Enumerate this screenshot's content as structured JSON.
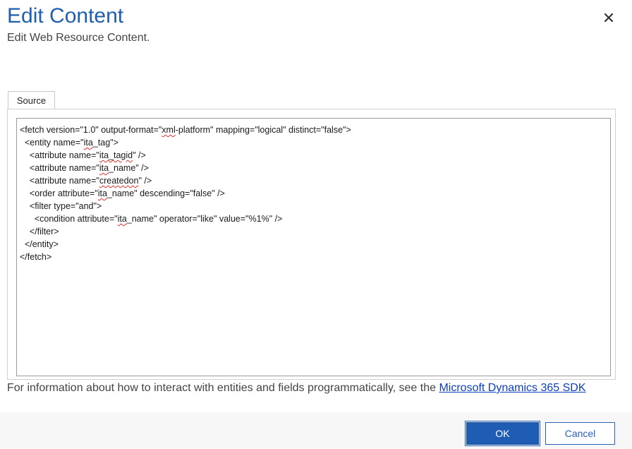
{
  "dialog": {
    "title": "Edit Content",
    "subtitle": "Edit Web Resource Content.",
    "close_icon": "close-icon"
  },
  "tabs": [
    {
      "label": "Source",
      "selected": true
    }
  ],
  "editor": {
    "lines": [
      [
        {
          "t": "<fetch version=\"1.0\" output-format=\""
        },
        {
          "t": "xml",
          "sq": true
        },
        {
          "t": "-platform\" mapping=\"logical\" distinct=\"false\">"
        }
      ],
      [
        {
          "t": "  <entity name=\""
        },
        {
          "t": "ita",
          "sq": true
        },
        {
          "t": "_tag\">"
        }
      ],
      [
        {
          "t": "    <attribute name=\""
        },
        {
          "t": "ita_tagid",
          "sq": true
        },
        {
          "t": "\" />"
        }
      ],
      [
        {
          "t": "    <attribute name=\""
        },
        {
          "t": "ita",
          "sq": true
        },
        {
          "t": "_name\" />"
        }
      ],
      [
        {
          "t": "    <attribute name=\""
        },
        {
          "t": "createdon",
          "sq": true
        },
        {
          "t": "\" />"
        }
      ],
      [
        {
          "t": "    <order attribute=\""
        },
        {
          "t": "ita",
          "sq": true
        },
        {
          "t": "_name\" descending=\"false\" />"
        }
      ],
      [
        {
          "t": "    <filter type=\"and\">"
        }
      ],
      [
        {
          "t": "      <condition attribute=\""
        },
        {
          "t": "ita",
          "sq": true
        },
        {
          "t": "_name\" operator=\"like\" value=\"%1%\" />"
        }
      ],
      [
        {
          "t": "    </filter>"
        }
      ],
      [
        {
          "t": "  </entity>"
        }
      ],
      [
        {
          "t": "</fetch>"
        }
      ]
    ]
  },
  "info": {
    "text": "For information about how to interact with entities and fields programmatically, see the ",
    "link_text": "Microsoft Dynamics 365 SDK"
  },
  "buttons": {
    "ok_label": "OK",
    "cancel_label": "Cancel"
  },
  "colors": {
    "title": "#1f5fae",
    "primary_button": "#1e5db3",
    "link": "#0b3fbd",
    "spellcheck": "#e0302a"
  }
}
